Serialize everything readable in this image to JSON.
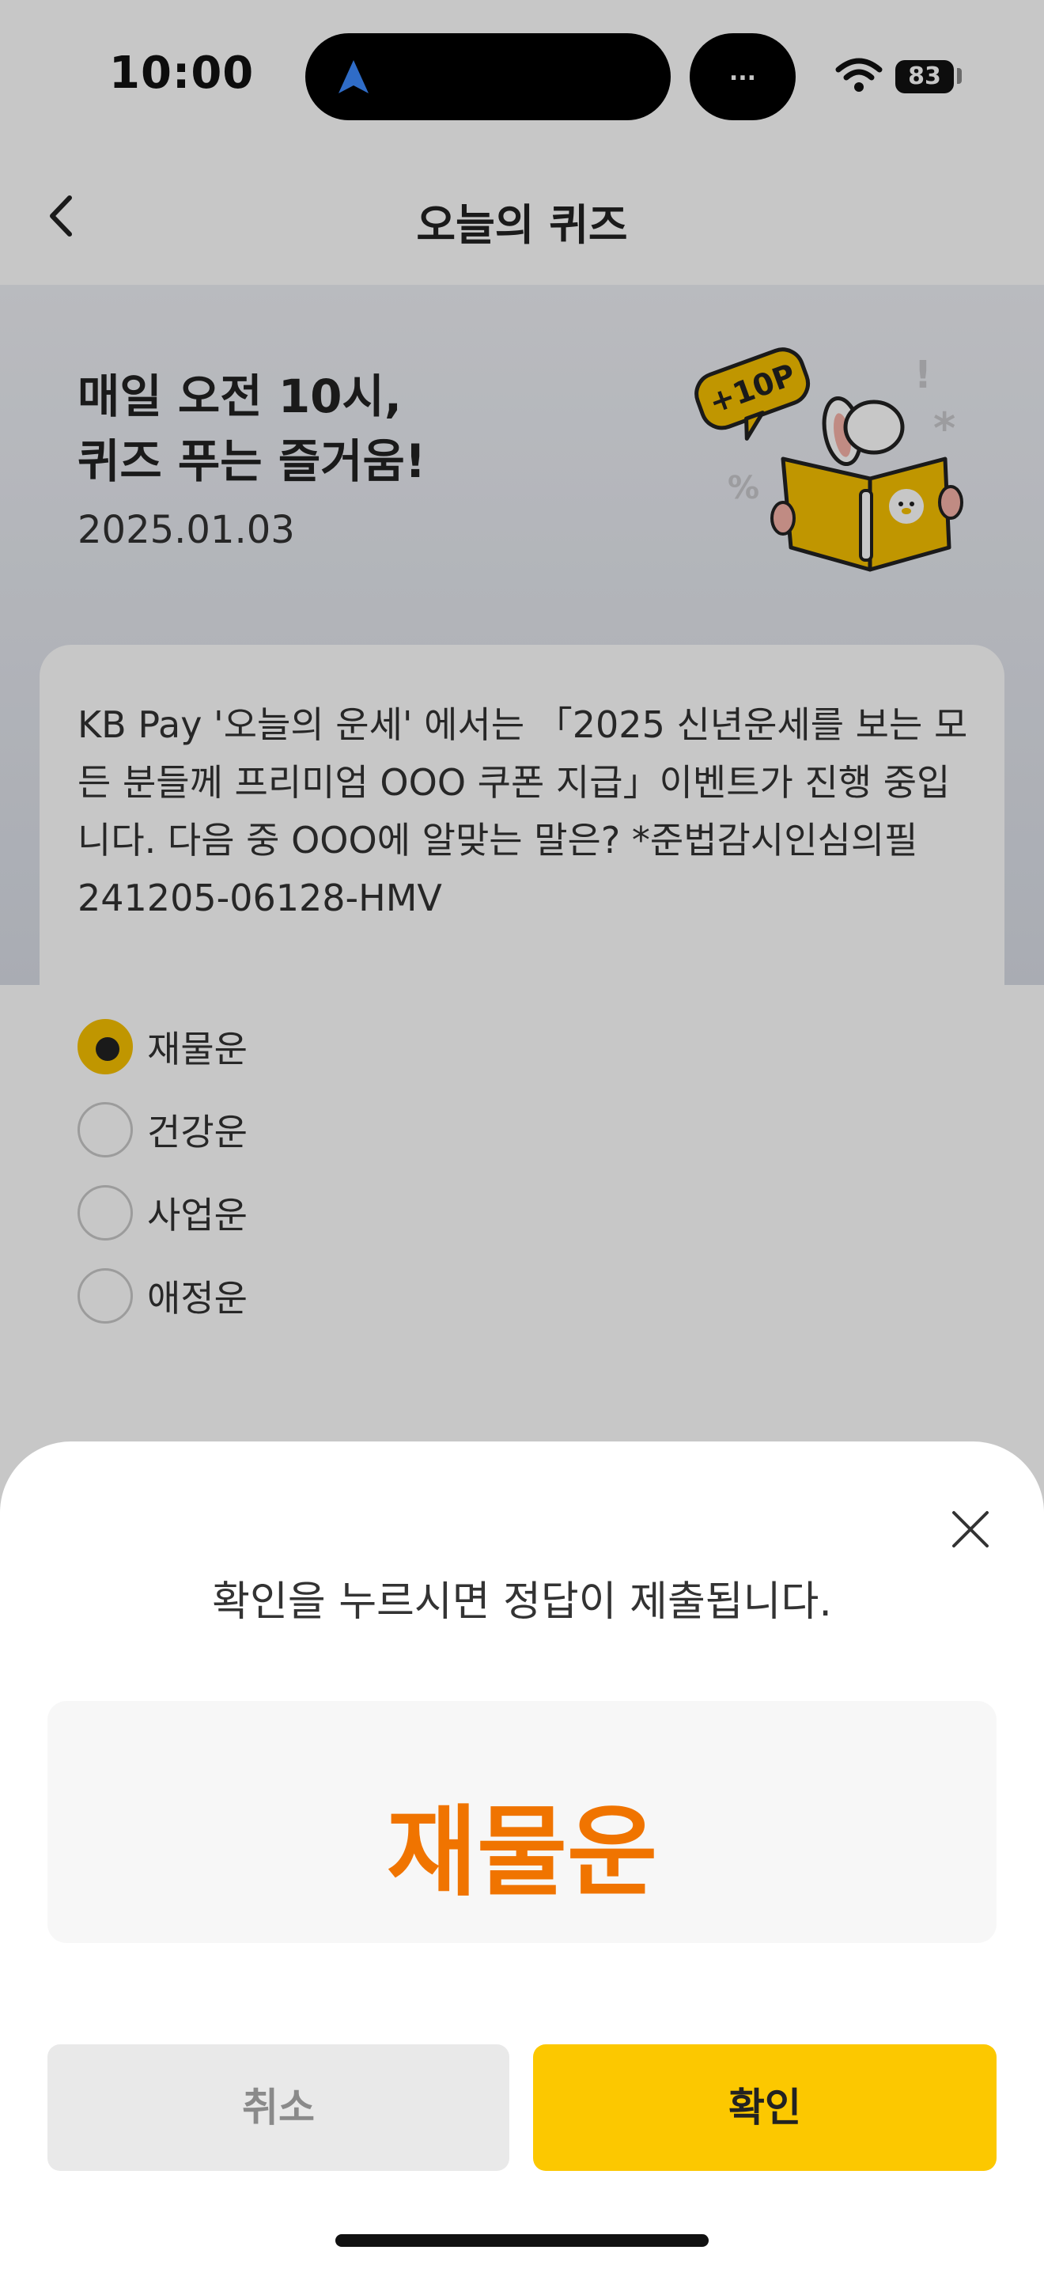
{
  "status_bar": {
    "time": "10:00",
    "battery": "83",
    "activity_label": "...",
    "accent": "#3d8bff"
  },
  "header": {
    "title": "오늘의 퀴즈"
  },
  "hero": {
    "title_line1": "매일 오전 10시,",
    "title_line2": "퀴즈 푸는 즐거움!",
    "date": "2025.01.03",
    "badge": "+10P"
  },
  "quiz": {
    "question": "KB Pay '오늘의 운세' 에서는 「2025 신년운세를 보는 모든 분들께 프리미엄 OOO 쿠폰 지급」이벤트가 진행 중입니다. 다음 중 OOO에 알맞는 말은? *준법감시인심의필 241205-06128-HMV",
    "options": [
      {
        "label": "재물운",
        "selected": true
      },
      {
        "label": "건강운",
        "selected": false
      },
      {
        "label": "사업운",
        "selected": false
      },
      {
        "label": "애정운",
        "selected": false
      }
    ]
  },
  "sheet": {
    "message": "확인을 누르시면 정답이 제출됩니다.",
    "answer": "재물운",
    "cancel_label": "취소",
    "confirm_label": "확인"
  },
  "colors": {
    "answer": "#f07400",
    "confirm": "#fcc800",
    "radio_selected": "#f6c000"
  }
}
